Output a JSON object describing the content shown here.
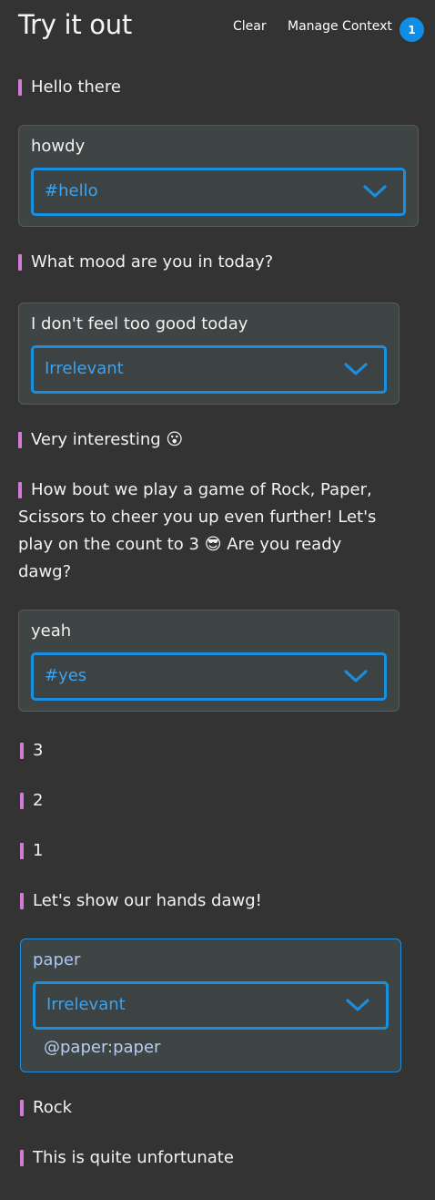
{
  "header": {
    "title": "Try it out",
    "clear_label": "Clear",
    "context_label": "Manage Context",
    "context_count": "1"
  },
  "messages": {
    "m1": "Hello there",
    "m2": "What mood are you in today?",
    "m3": "Very interesting 😮",
    "m4": "How bout we play a game of Rock, Paper, Scissors to cheer you up even further! Let's play on the count to 3 😎 Are you ready dawg?",
    "m5": "3",
    "m6": "2",
    "m7": "1",
    "m8": "Let's show our hands dawg!",
    "m9": "Rock",
    "m10": "This is quite unfortunate"
  },
  "responses": {
    "r1": {
      "text": "howdy",
      "intent": "#hello"
    },
    "r2": {
      "text": "I don't feel too good today",
      "intent": "Irrelevant"
    },
    "r3": {
      "text": "yeah",
      "intent": "#yes"
    },
    "r4": {
      "text": "paper",
      "intent": "Irrelevant",
      "entity": "@paper:paper"
    }
  },
  "colors": {
    "background": "#333333",
    "accent": "#1a8fe0",
    "bot_marker": "#d27ad4",
    "card_background": "#3f4445"
  },
  "icons": {
    "dropdown": "chevron-down-icon"
  }
}
